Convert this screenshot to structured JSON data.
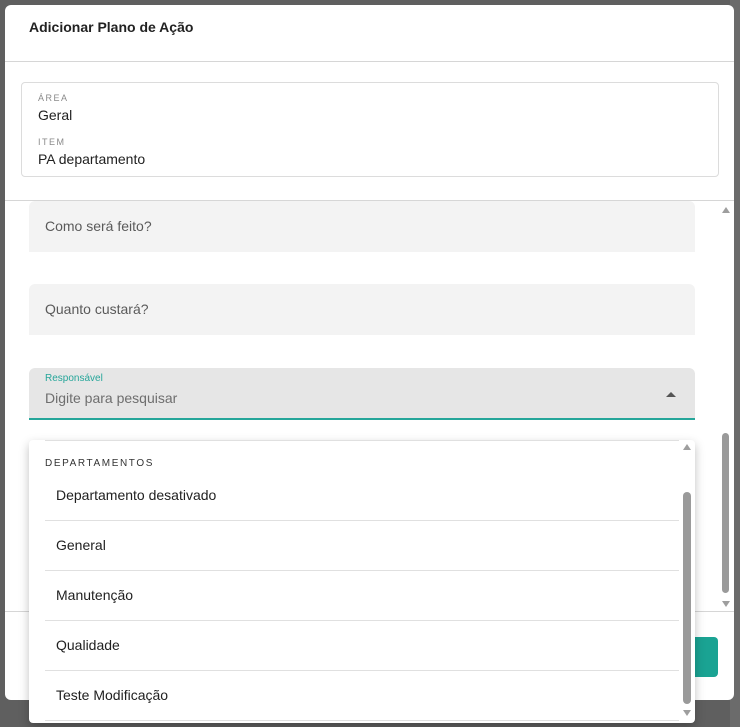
{
  "dialog": {
    "title": "Adicionar Plano de Ação"
  },
  "info": {
    "area_label": "ÁREA",
    "area_value": "Geral",
    "item_label": "ITEM",
    "item_value": "PA departamento"
  },
  "fields": {
    "como": "Como será feito?",
    "quanto": "Quanto custará?"
  },
  "responsavel": {
    "label": "Responsável",
    "placeholder": "Digite para pesquisar"
  },
  "menu": {
    "group": "DEPARTAMENTOS",
    "items": [
      {
        "label": "Departamento desativado"
      },
      {
        "label": "General"
      },
      {
        "label": "Manutenção"
      },
      {
        "label": "Qualidade"
      },
      {
        "label": "Teste Modificação"
      }
    ]
  },
  "colors": {
    "accent": "#26a69a",
    "button": "#1aa393",
    "backdrop": "#5f5f5f"
  }
}
